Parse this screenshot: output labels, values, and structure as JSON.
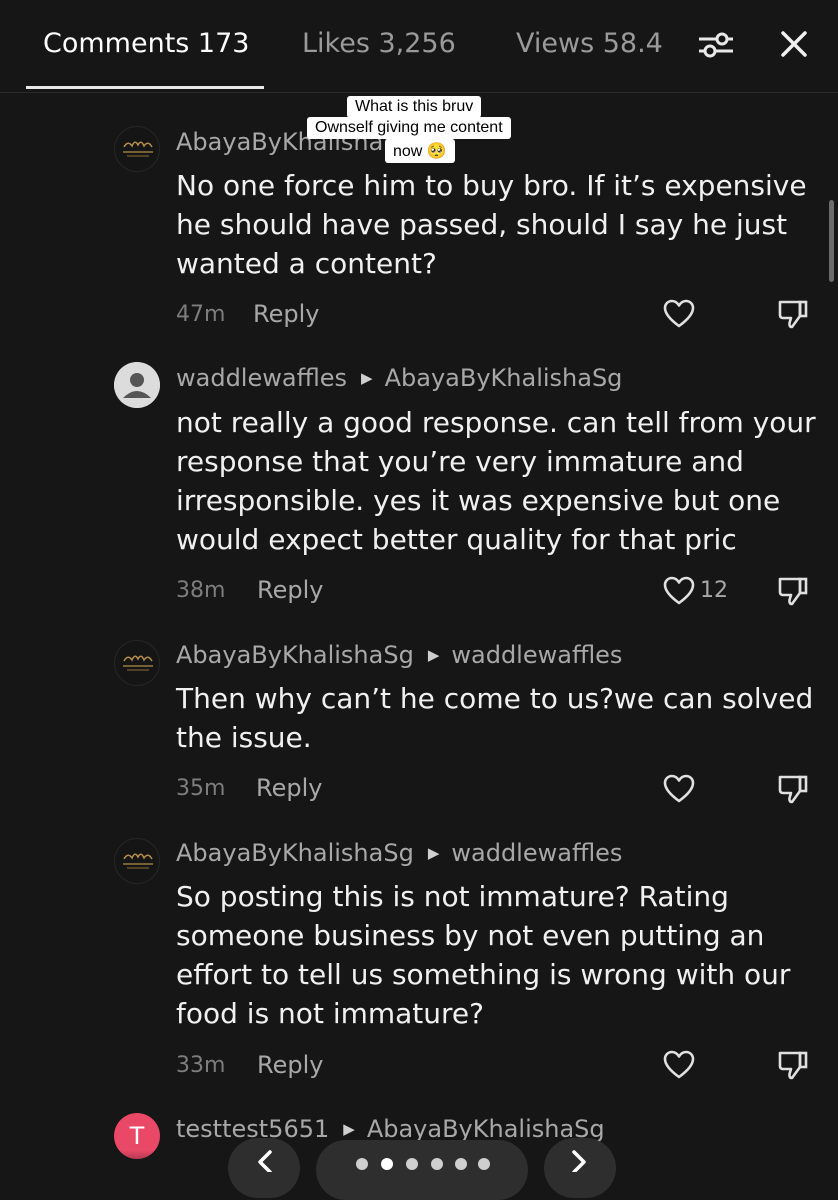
{
  "tabs": {
    "comments": "Comments 173",
    "likes": "Likes 3,256",
    "views": "Views 58.4"
  },
  "sticker": {
    "line1": "What is this bruv",
    "line2": "Ownself giving me content",
    "line3": "now 🥺"
  },
  "comments": [
    {
      "author": "AbayaByKhalishaSg",
      "reply_to": "",
      "text": "No one force him to buy bro. If it’s expensive he should have passed, should I say he just wanted a content?",
      "time": "47m",
      "reply_label": "Reply",
      "likes": ""
    },
    {
      "author": "waddlewaffles",
      "reply_to": "AbayaByKhalishaSg",
      "text": "not really a good response. can tell from your response that you’re very immature and irresponsible. yes it was expensive but one would expect better quality for that pric",
      "time": "38m",
      "reply_label": "Reply",
      "likes": "12"
    },
    {
      "author": "AbayaByKhalishaSg",
      "reply_to": "waddlewaffles",
      "text": "Then why can’t he come to us?we can solved the issue.",
      "time": "35m",
      "reply_label": "Reply",
      "likes": ""
    },
    {
      "author": "AbayaByKhalishaSg",
      "reply_to": "waddlewaffles",
      "text": "So posting this is not immature? Rating someone business by not even putting an effort to tell us something is wrong with our food is not immature?",
      "time": "33m",
      "reply_label": "Reply",
      "likes": ""
    },
    {
      "author": "testtest5651",
      "reply_to": "AbayaByKhalishaSg",
      "avatar_letter": "T"
    }
  ],
  "pager": {
    "total": 6,
    "active": 1
  },
  "icons": {
    "filter": "filter-sliders-icon",
    "close": "close-icon",
    "like": "heart-icon",
    "dislike": "thumbs-down-icon",
    "prev": "chevron-left-icon",
    "next": "chevron-right-icon"
  }
}
